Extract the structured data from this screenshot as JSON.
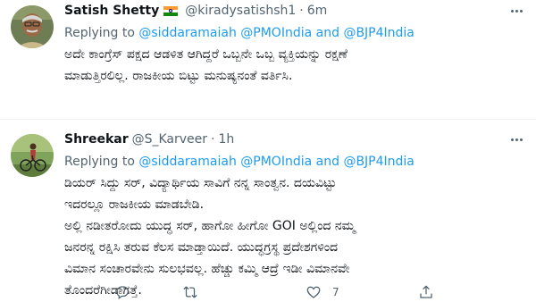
{
  "tweets": [
    {
      "name": "Satish Shetty",
      "handle": "@kiradysatishsh1",
      "separator": "·",
      "time": "6m",
      "replying_prefix": "Replying to ",
      "mention1": "@siddaramaiah",
      "mention2": "@PMOIndia",
      "replying_and": " and ",
      "mention3": "@BJP4India",
      "body_lines": [
        "ಅದೇ ಕಾಂಗ್ರೆಸ್ ಪಕ್ಷದ ಆಡಳಿತ ಆಗಿದ್ದರೆ ಒಬ್ಬನೇ ಒಬ್ಬ ವ್ಯಕ್ತಿಯನ್ನು ರಕ್ಷಣೆ",
        "ಮಾಡುತ್ತಿರಲಿಲ್ಲ. ರಾಜಕೀಯ ಬಿಟ್ಟು ಮನುಷ್ಯನಂತೆ ವರ್ತಿಸಿ."
      ]
    },
    {
      "name": "Shreekar",
      "handle": "@S_Karveer",
      "separator": "·",
      "time": "1h",
      "replying_prefix": "Replying to ",
      "mention1": "@siddaramaiah",
      "mention2": "@PMOIndia",
      "replying_and": " and ",
      "mention3": "@BJP4India",
      "body_lines": [
        "ಡಿಯರ್ ಸಿದ್ದು ಸರ್, ವಿದ್ಯಾರ್ಥಿಯ ಸಾವಿಗೆ ನನ್ನ ಸಾಂತ್ವನ. ದಯವಿಟ್ಟು",
        "ಇದರಲ್ಲೂ ರಾಜಕೀಯ ಮಾಡಬೇಡಿ.",
        "ಅಲ್ಲಿ ನಡೀತರೋದು ಯುದ್ಧ ಸರ್, ಹಾಗೋ ಹೀಗೋ GOI ಅಲ್ಲಿಂದ ನಮ್ಮ",
        "ಜನರನ್ನ ರಕ್ಷಿಸಿ ತರುವ ಕೆಲಸ ಮಾಡ್ತಾಯಿದೆ. ಯುದ್ಧಗ್ರಸ್ಥ ಪ್ರದೇಶಗಳಿಂದ",
        "ವಿಮಾನ ಸಂಚಾರವೇನು ಸುಲಭವಲ್ಲ. ಹೆಚ್ಚು ಕಮ್ಮಿ ಆದ್ರೆ ಇಡೀ ವಿಮಾನವೇ",
        "ತೊಂದರೆಗೀಡಾಗತ್ತೆ."
      ],
      "like_count": "7"
    }
  ],
  "colors": {
    "link": "#1d9bf0",
    "muted": "#536471",
    "text": "#0f1419"
  },
  "icons": {
    "reply": "reply-icon",
    "retweet": "retweet-icon",
    "like": "heart-icon",
    "share": "share-icon",
    "more": "more-icon",
    "flag": "india-flag-icon"
  }
}
